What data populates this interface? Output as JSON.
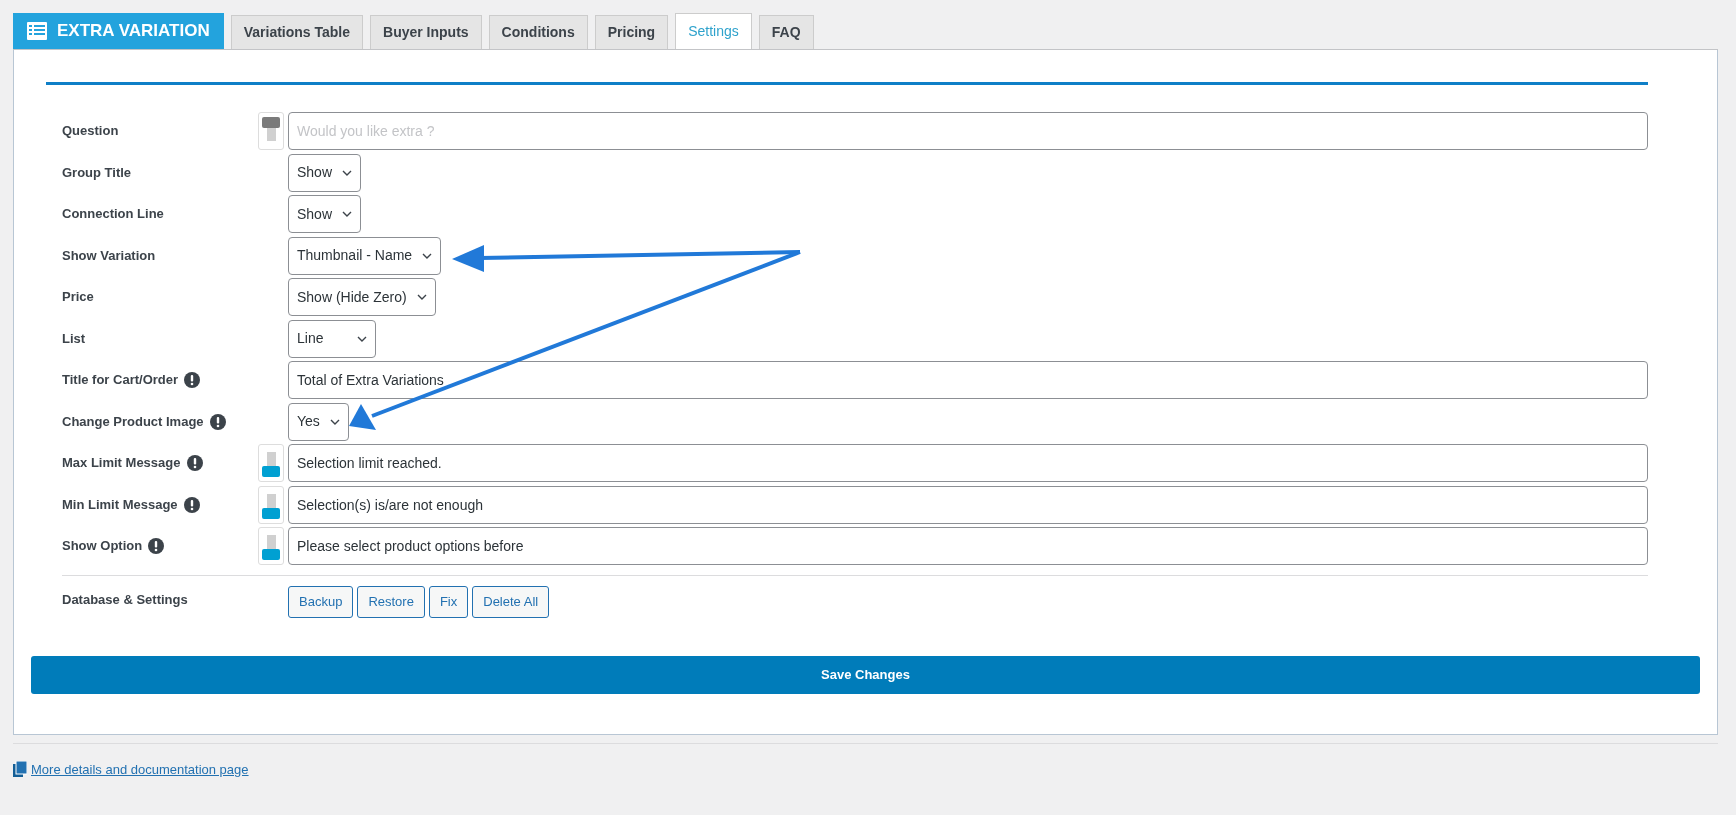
{
  "header": {
    "logo": "EXTRA VARIATION"
  },
  "tabs": [
    {
      "label": "Variations Table",
      "selected": false
    },
    {
      "label": "Buyer Inputs",
      "selected": false
    },
    {
      "label": "Conditions",
      "selected": false
    },
    {
      "label": "Pricing",
      "selected": false
    },
    {
      "label": "Settings",
      "selected": true
    },
    {
      "label": "FAQ",
      "selected": false
    }
  ],
  "settings": [
    {
      "label": "Question",
      "info": false,
      "toggle": {
        "on": false
      },
      "field": {
        "kind": "input",
        "placeholder": "Would you like extra ?"
      }
    },
    {
      "label": "Group Title",
      "info": false,
      "field": {
        "kind": "select",
        "value": "Show"
      }
    },
    {
      "label": "Connection Line",
      "info": false,
      "field": {
        "kind": "select",
        "value": "Show"
      }
    },
    {
      "label": "Show Variation",
      "info": false,
      "field": {
        "kind": "select",
        "value": "Thumbnail - Name"
      }
    },
    {
      "label": "Price",
      "info": false,
      "field": {
        "kind": "select",
        "value": "Show (Hide Zero)"
      }
    },
    {
      "label": "List",
      "info": false,
      "field": {
        "kind": "select",
        "value": "Line",
        "wide": true
      }
    },
    {
      "label": "Title for Cart/Order",
      "info": true,
      "field": {
        "kind": "input",
        "value": "Total of Extra Variations"
      }
    },
    {
      "label": "Change Product Image",
      "info": true,
      "field": {
        "kind": "select",
        "value": "Yes"
      }
    },
    {
      "label": "Max Limit Message",
      "info": true,
      "toggle": {
        "on": true
      },
      "field": {
        "kind": "input",
        "value": "Selection limit reached."
      }
    },
    {
      "label": "Min Limit Message",
      "info": true,
      "toggle": {
        "on": true
      },
      "field": {
        "kind": "input",
        "value": "Selection(s) is/are not enough"
      }
    },
    {
      "label": "Show Option",
      "info": true,
      "toggle": {
        "on": true
      },
      "field": {
        "kind": "input",
        "value": "Please select product options before"
      }
    }
  ],
  "database": {
    "label": "Database & Settings",
    "buttons": [
      "Backup",
      "Restore",
      "Fix",
      "Delete All"
    ]
  },
  "save_button": "Save Changes",
  "footer_link": "More details and documentation page"
}
